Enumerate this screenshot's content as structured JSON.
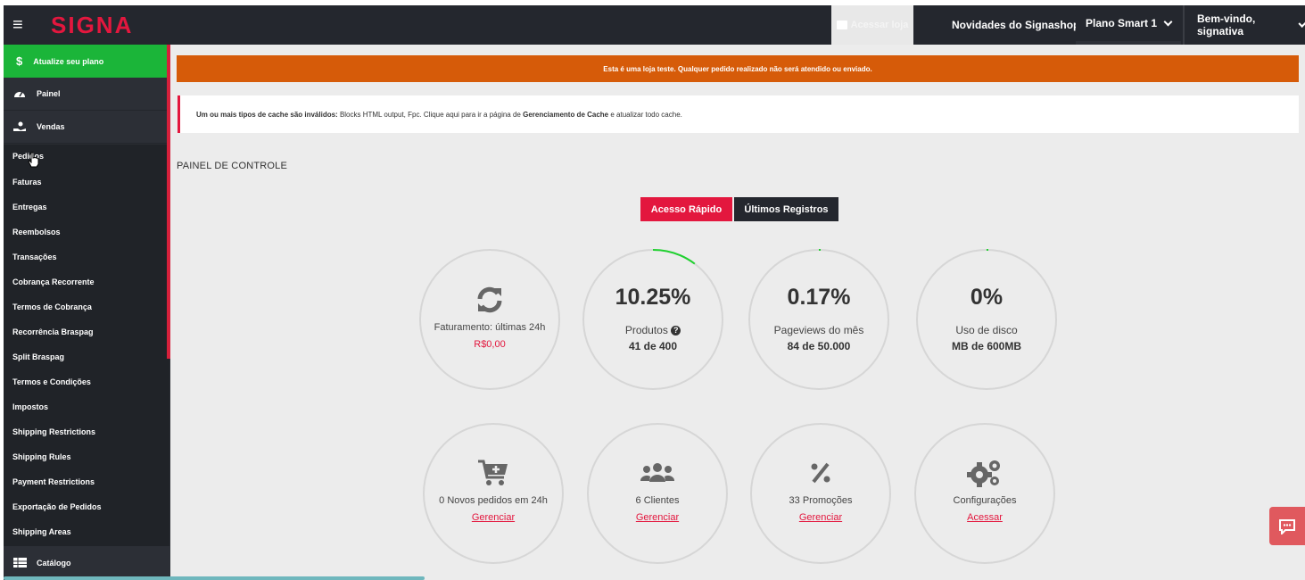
{
  "topbar": {
    "logo": "SIGNA",
    "store_link": "Acessar loja",
    "news": "Novidades do Signashop",
    "plan": "Plano Smart 1",
    "welcome": "Bem-vindo, signativa"
  },
  "sidebar": {
    "upgrade": "Atualize seu plano",
    "panel": "Painel",
    "sales": "Vendas",
    "catalog": "Catálogo",
    "sub_items": [
      "Pedidos",
      "Faturas",
      "Entregas",
      "Reembolsos",
      "Transações",
      "Cobrança Recorrente",
      "Termos de Cobrança",
      "Recorrência Braspag",
      "Split Braspag",
      "Termos e Condições",
      "Impostos",
      "Shipping Restrictions",
      "Shipping Rules",
      "Payment Restrictions",
      "Exportação de Pedidos",
      "Shipping Areas"
    ]
  },
  "banner": "Esta é uma loja teste. Qualquer pedido realizado não será atendido ou enviado.",
  "cache_notice": {
    "part1": "Um ou mais tipos de cache são inválidos:",
    "part2": " Blocks HTML output, Fpc. Clique aqui para ir a página de ",
    "part3": "Gerenciamento de Cache",
    "part4": " e atualizar todo cache."
  },
  "panel_title": "PAINEL DE CONTROLE",
  "tabs": {
    "quick": "Acesso Rápido",
    "records": "Últimos Registros"
  },
  "stats": {
    "revenue": {
      "label": "Faturamento: últimas 24h",
      "value": "R$0,00",
      "icon": "refresh-icon"
    },
    "products": {
      "big": "10.25%",
      "label": "Produtos",
      "value": "41 de 400",
      "progress": 0.1025,
      "icon": "question-circle-icon"
    },
    "pageviews": {
      "big": "0.17%",
      "label": "Pageviews do mês",
      "value": "84 de 50.000",
      "progress": 0.0017
    },
    "disk": {
      "big": "0%",
      "label": "Uso de disco",
      "value": "MB de 600MB",
      "progress": 0.0
    }
  },
  "shortcuts": {
    "orders": {
      "label": "0 Novos pedidos em 24h",
      "link": "Gerenciar",
      "icon": "cart-plus-icon"
    },
    "customers": {
      "label": "6 Clientes",
      "link": "Gerenciar",
      "icon": "users-icon"
    },
    "promotions": {
      "label": "33 Promoções",
      "link": "Gerenciar",
      "icon": "percent-icon"
    },
    "settings": {
      "label": "Configurações",
      "link": "Acessar",
      "icon": "cogs-icon"
    }
  },
  "colors": {
    "brand_red": "#e3173e",
    "upgrade_green": "#1bb539",
    "banner_orange": "#d65b09",
    "progress_green": "#1fd12f"
  }
}
